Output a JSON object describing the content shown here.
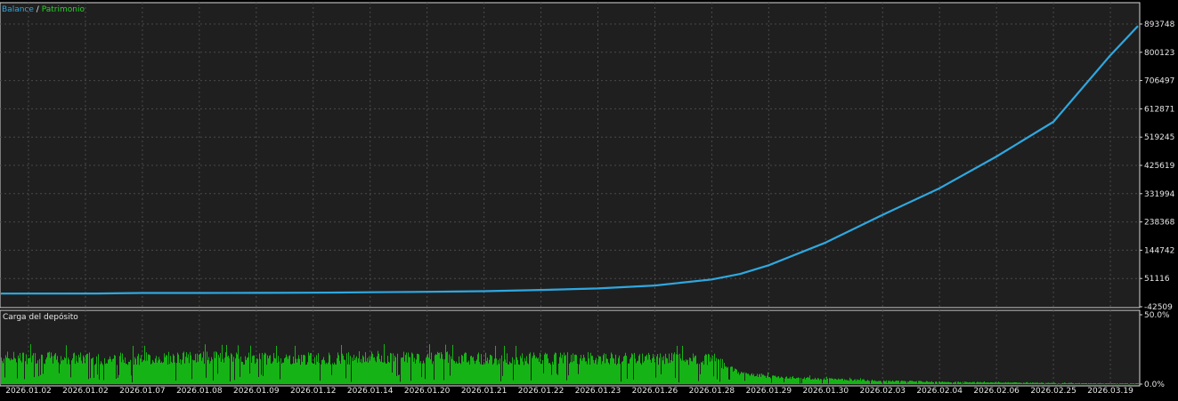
{
  "colors": {
    "background": "#000000",
    "panel_bg": "#1f1f1f",
    "grid": "#4a4a4a",
    "frame": "#d8d8d8",
    "text": "#e6e6e6",
    "balance": "#2fa7e0",
    "equity": "#2bd22b",
    "load": "#16b316"
  },
  "legend": {
    "balance_label": "Balance",
    "separator": "/",
    "equity_label": "Patrimonio"
  },
  "lower_panel": {
    "title": "Carga del depósito"
  },
  "chart_data": [
    {
      "type": "line",
      "grid": true,
      "y_axis_position": "right",
      "legend_placement": "top-left",
      "y_ticks": [
        "893748",
        "800123",
        "706497",
        "612871",
        "519245",
        "425619",
        "331994",
        "238368",
        "144742",
        "51116",
        "-42509"
      ],
      "ylim": [
        -42509,
        893748
      ],
      "x_categories": [
        "2026.01.02",
        "2026.01.02",
        "2026.01.07",
        "2026.01.08",
        "2026.01.09",
        "2026.01.12",
        "2026.01.14",
        "2026.01.20",
        "2026.01.21",
        "2026.01.22",
        "2026.01.23",
        "2026.01.26",
        "2026.01.28",
        "2026.01.29",
        "2026.01.30",
        "2026.02.03",
        "2026.02.04",
        "2026.02.06",
        "2026.02.25",
        "2026.03.19"
      ],
      "series": [
        {
          "name": "Balance",
          "x": [
            0,
            1.2,
            2,
            3,
            4,
            5,
            6,
            7,
            8,
            9,
            10,
            11,
            12,
            12.5,
            13,
            14,
            15,
            16,
            17,
            18,
            19,
            20.1
          ],
          "y": [
            1000,
            1500,
            3000,
            3200,
            3400,
            4000,
            5500,
            7000,
            9000,
            13000,
            18000,
            28000,
            48000,
            66000,
            95000,
            170000,
            262000,
            350000,
            455000,
            570000,
            790000,
            887000
          ]
        },
        {
          "name": "Patrimonio",
          "x": [
            0,
            1.2,
            2,
            3,
            4,
            5,
            6,
            7,
            8,
            9,
            10,
            11,
            12,
            12.5,
            13,
            14,
            15,
            16,
            17,
            18,
            19,
            20.1
          ],
          "y": [
            1000,
            1500,
            3000,
            3200,
            3400,
            4000,
            5500,
            7000,
            9000,
            13000,
            18000,
            28000,
            48000,
            66000,
            95000,
            170000,
            262000,
            350000,
            455000,
            570000,
            790000,
            887000
          ]
        }
      ]
    },
    {
      "type": "bar",
      "title": "Carga del depósito",
      "y_ticks": [
        "50.0%",
        "0.0%"
      ],
      "ylim": [
        0,
        50
      ],
      "x": [
        0,
        1,
        2,
        3,
        4,
        5,
        6,
        7,
        8,
        9,
        10,
        11,
        12,
        12.5,
        13,
        14,
        15,
        16,
        17,
        18,
        19,
        20
      ],
      "values": [
        24,
        23,
        23,
        24,
        23,
        23,
        24,
        24,
        23,
        23,
        23,
        23,
        23,
        10,
        7,
        4.5,
        3,
        2,
        1.5,
        1,
        0.6,
        0.8
      ]
    }
  ]
}
